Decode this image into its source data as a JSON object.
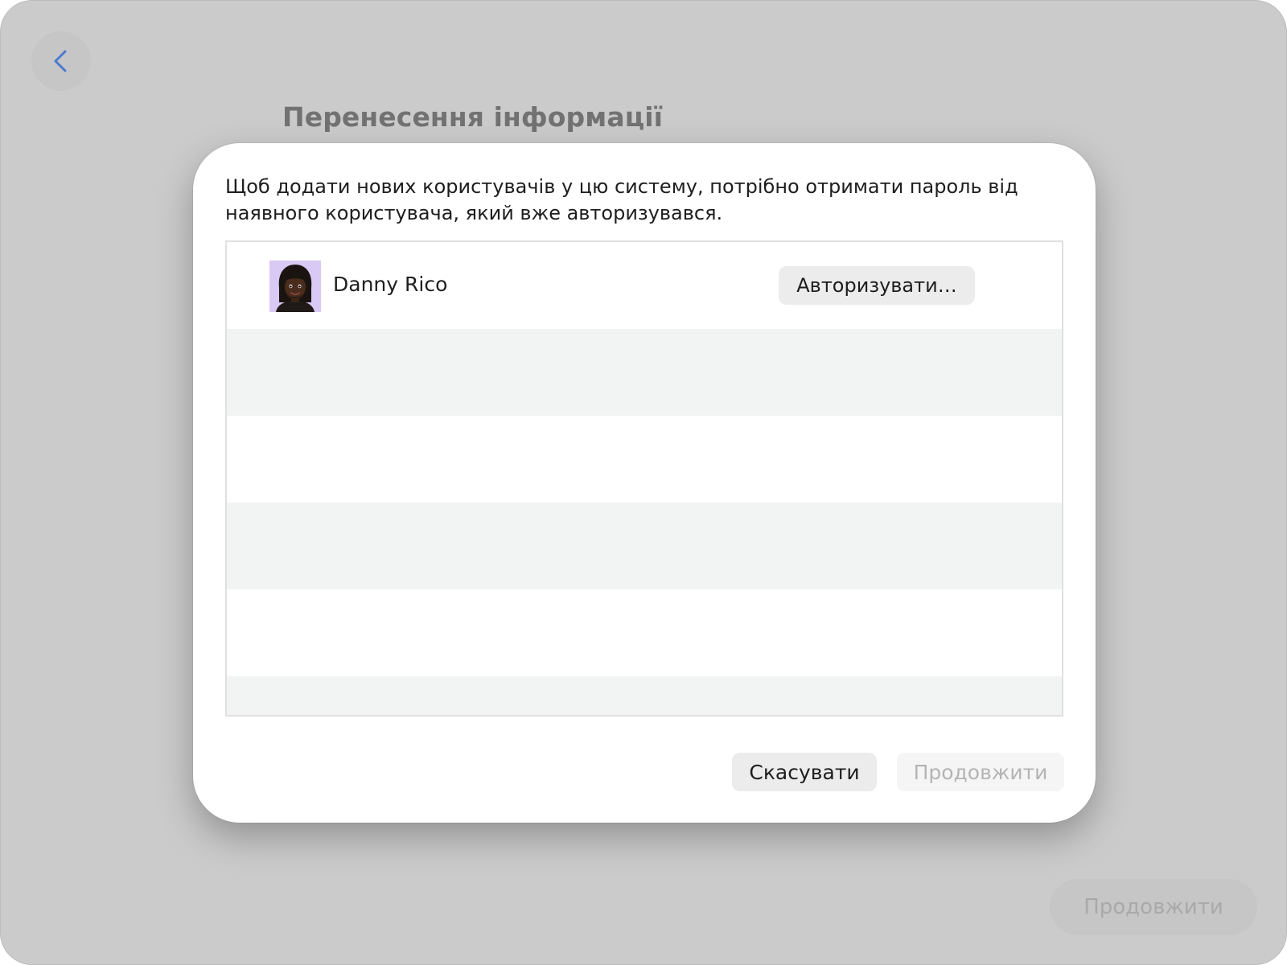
{
  "background": {
    "title": "Перенесення інформації",
    "continue_label": "Продовжити"
  },
  "dialog": {
    "message": "Щоб додати нових користувачів у цю систему, потрібно отримати пароль від наявного користувача, який вже авторизувався.",
    "users": [
      {
        "name": "Danny Rico",
        "authorize_label": "Авторизувати…"
      }
    ],
    "cancel_label": "Скасувати",
    "continue_label": "Продовжити"
  },
  "colors": {
    "backdrop": "#cbcbcb",
    "accent": "#4a7bd0",
    "avatar_bg": "#d9c9f5",
    "row_alt": "#f2f4f3",
    "disabled_text": "#b4b4b4"
  },
  "icons": {
    "back": "chevron-left-icon",
    "avatar": "memoji-avatar"
  }
}
